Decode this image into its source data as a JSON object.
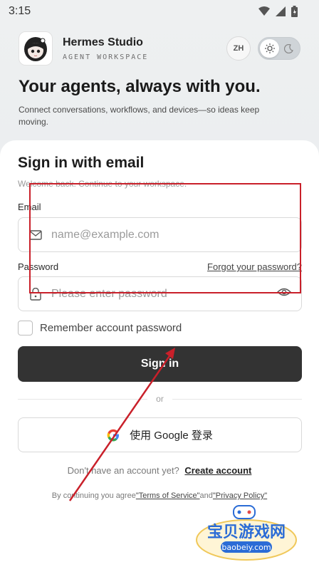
{
  "status": {
    "time": "3:15",
    "icons": [
      "wifi-icon",
      "signal-icon",
      "battery-icon"
    ]
  },
  "header": {
    "brand_name": "Hermes Studio",
    "brand_sub": "AGENT WORKSPACE",
    "lang_label": "ZH",
    "theme": {
      "options": [
        "sun-icon",
        "moon-icon"
      ],
      "active": "light"
    }
  },
  "hero": {
    "title": "Your agents, always with you.",
    "subtitle": "Connect conversations, workflows, and devices—so ideas keep moving."
  },
  "form": {
    "title": "Sign in with email",
    "subtitle": "Welcome back. Continue to your workspace.",
    "email_label": "Email",
    "email_placeholder": "name@example.com",
    "password_label": "Password",
    "forgot_label": "Forgot your password?",
    "password_placeholder": "Please enter password",
    "remember_label": "Remember account password",
    "signin_label": "Sign in",
    "or_label": "or",
    "google_label": "使用 Google 登录",
    "no_account_text": "Don't have an account yet?",
    "create_account_label": "Create account",
    "terms_prefix": "By continuing you agree",
    "terms_link": "\"Terms of Service\"",
    "terms_and": "and",
    "privacy_link": "\"Privacy Policy\""
  },
  "watermark": {
    "text": "宝贝游戏网",
    "url": "baobeiy.com"
  },
  "colors": {
    "annotation": "#c9202a",
    "primary_button": "#333333",
    "card": "#ffffff"
  }
}
